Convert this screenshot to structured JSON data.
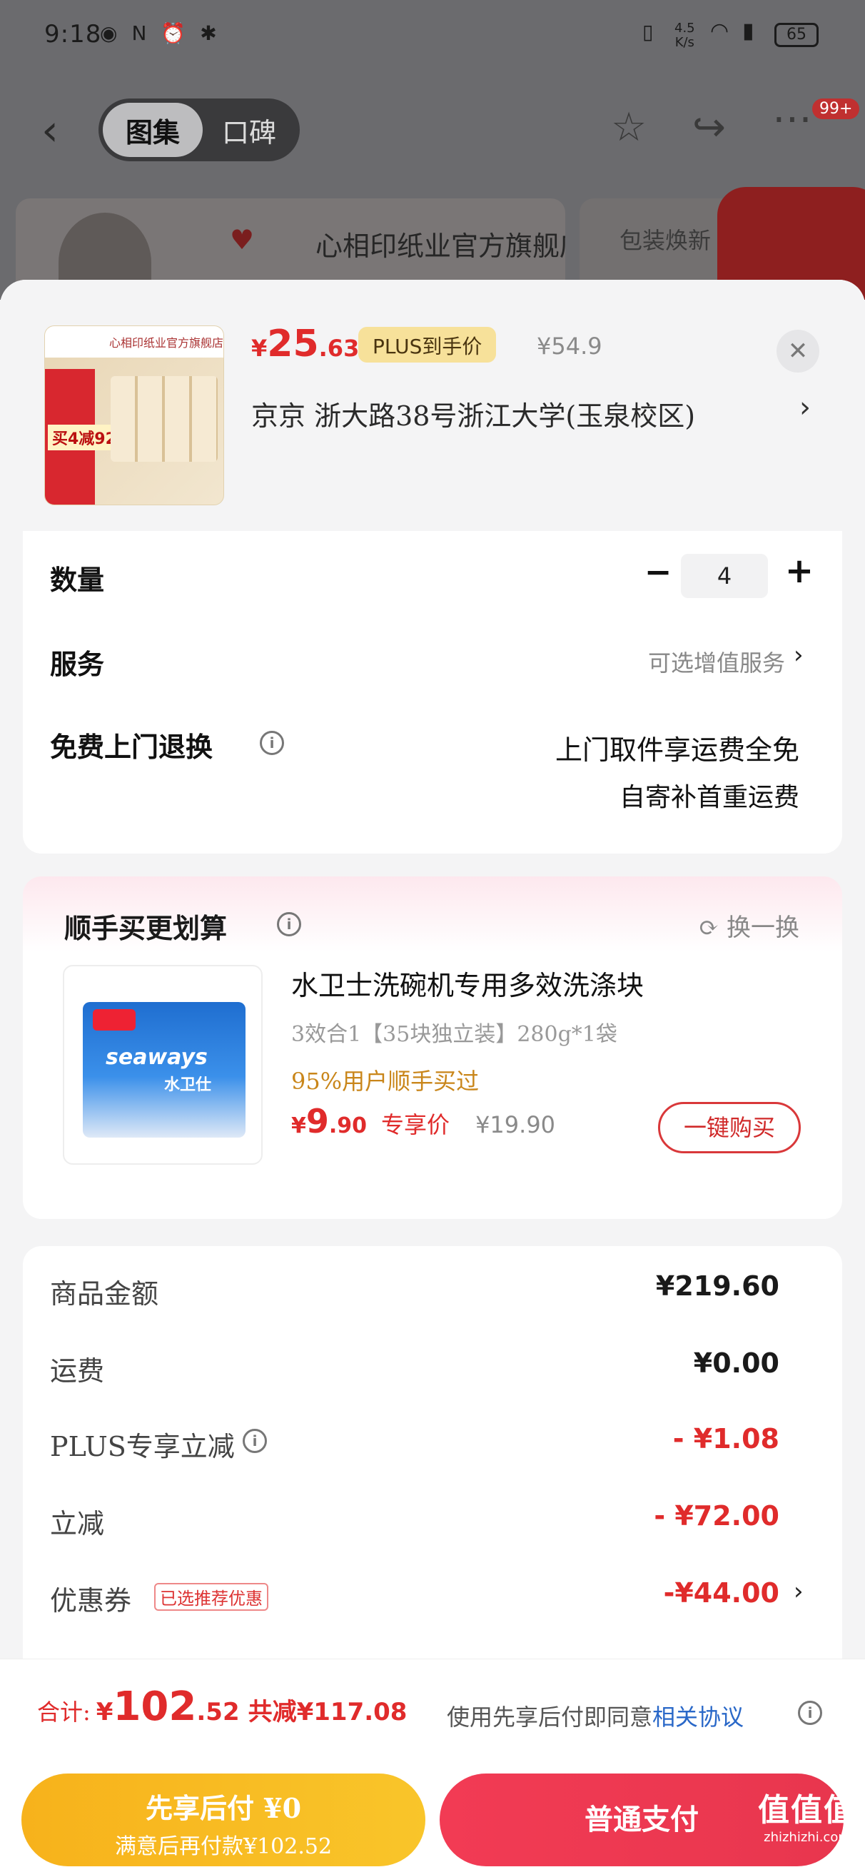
{
  "status_bar": {
    "time": "9:18",
    "net_speed_value": "4.5",
    "net_speed_unit": "K/s",
    "battery": "65"
  },
  "top_nav": {
    "tab_gallery": "图集",
    "tab_reviews": "口碑",
    "badge": "99+"
  },
  "banner": {
    "shop_name": "心相印纸业官方旗舰店",
    "package_text": "包装焕新"
  },
  "product": {
    "price_symbol": "¥",
    "price_integer": "25",
    "price_decimal": ".63",
    "plus_label": "PLUS到手价",
    "original_price": "¥54.9",
    "address": "京京  浙大路38号浙江大学(玉泉校区)",
    "thumb_shop": "心相印纸业官方旗舰店",
    "thumb_promo": "买4减92"
  },
  "options": {
    "quantity_label": "数量",
    "quantity_value": "4",
    "minus": "−",
    "plus": "+",
    "service_label": "服务",
    "service_value": "可选增值服务",
    "return_label": "免费上门退换",
    "return_line1": "上门取件享运费全免",
    "return_line2": "自寄补首重运费"
  },
  "deal": {
    "title": "顺手买更划算",
    "refresh": "换一换",
    "name": "水卫士洗碗机专用多效洗涤块",
    "spec": "3效合1【35块独立装】280g*1袋",
    "stat": "95%用户顺手买过",
    "price_symbol": "¥",
    "price_integer": "9",
    "price_decimal": ".90",
    "exclusive": "专享价",
    "original_price": "¥19.90",
    "buy_button": "一键购买",
    "img_brand": "seaways",
    "img_cn": "水卫仕"
  },
  "summary": {
    "rows": [
      {
        "label": "商品金额",
        "value": "¥219.60"
      },
      {
        "label": "运费",
        "value": "¥0.00"
      },
      {
        "label": "PLUS专享立减",
        "value": "- ¥1.08"
      },
      {
        "label": "立减",
        "value": "- ¥72.00"
      },
      {
        "label": "优惠券",
        "value": "-¥44.00",
        "tag": "已选推荐优惠"
      }
    ]
  },
  "bottom": {
    "total_label": "合计:",
    "total_symbol": "¥",
    "total_integer": "102",
    "total_decimal": ".52",
    "total_cut": "共减¥117.08",
    "agree_text": "使用先享后付即同意",
    "agree_link": "相关协议",
    "pay_later_line1": "先享后付 ¥0",
    "pay_later_line2": "满意后再付款¥102.52",
    "pay_normal": "普通支付"
  },
  "watermark": {
    "main": "值值值",
    "sub": "zhizhizhi.com"
  },
  "colors": {
    "price_red": "#e02b2b",
    "plus_gold": "#f7e19a",
    "pay_later_yellow": "#f9b81f",
    "pay_normal_red": "#ee3a52",
    "link_blue": "#2a68c8"
  }
}
